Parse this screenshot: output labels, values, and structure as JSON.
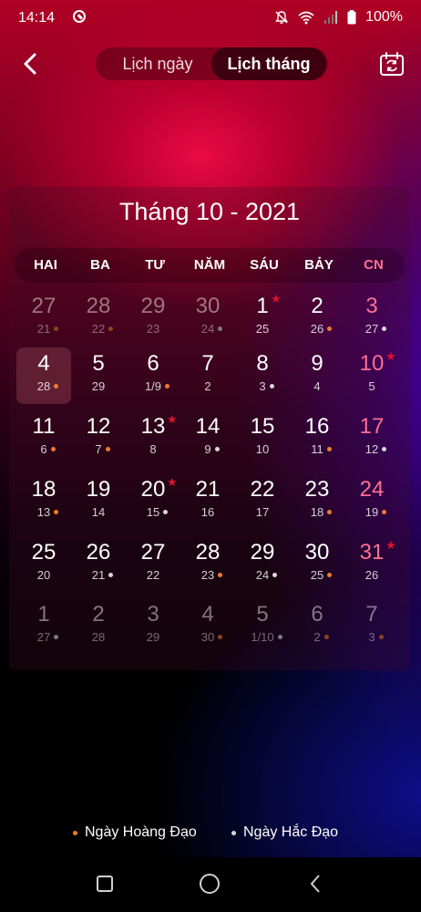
{
  "status": {
    "time": "14:14",
    "battery": "100%",
    "icons": [
      "app-notification-icon",
      "mute-icon",
      "wifi-icon",
      "signal-icon",
      "battery-icon"
    ]
  },
  "header": {
    "tab_day": "Lịch ngày",
    "tab_month": "Lịch tháng",
    "active_tab": "Lịch tháng"
  },
  "calendar": {
    "title": "Tháng 10 - 2021",
    "weekdays": [
      "HAI",
      "BA",
      "TƯ",
      "NĂM",
      "SÁU",
      "BẢY",
      "CN"
    ],
    "weeks": [
      [
        {
          "solar": "27",
          "lunar": "21",
          "dot": "good",
          "other": true
        },
        {
          "solar": "28",
          "lunar": "22",
          "dot": "good",
          "other": true
        },
        {
          "solar": "29",
          "lunar": "23",
          "dot": "",
          "other": true
        },
        {
          "solar": "30",
          "lunar": "24",
          "dot": "bad",
          "other": true
        },
        {
          "solar": "1",
          "lunar": "25",
          "dot": "",
          "star": true
        },
        {
          "solar": "2",
          "lunar": "26",
          "dot": "good"
        },
        {
          "solar": "3",
          "lunar": "27",
          "dot": "bad"
        }
      ],
      [
        {
          "solar": "4",
          "lunar": "28",
          "dot": "good",
          "today": true
        },
        {
          "solar": "5",
          "lunar": "29",
          "dot": ""
        },
        {
          "solar": "6",
          "lunar": "1/9",
          "dot": "good"
        },
        {
          "solar": "7",
          "lunar": "2",
          "dot": ""
        },
        {
          "solar": "8",
          "lunar": "3",
          "dot": "bad"
        },
        {
          "solar": "9",
          "lunar": "4",
          "dot": ""
        },
        {
          "solar": "10",
          "lunar": "5",
          "dot": "",
          "star": true
        }
      ],
      [
        {
          "solar": "11",
          "lunar": "6",
          "dot": "good"
        },
        {
          "solar": "12",
          "lunar": "7",
          "dot": "good"
        },
        {
          "solar": "13",
          "lunar": "8",
          "dot": "",
          "star": true
        },
        {
          "solar": "14",
          "lunar": "9",
          "dot": "bad"
        },
        {
          "solar": "15",
          "lunar": "10",
          "dot": ""
        },
        {
          "solar": "16",
          "lunar": "11",
          "dot": "good"
        },
        {
          "solar": "17",
          "lunar": "12",
          "dot": "bad"
        }
      ],
      [
        {
          "solar": "18",
          "lunar": "13",
          "dot": "good"
        },
        {
          "solar": "19",
          "lunar": "14",
          "dot": ""
        },
        {
          "solar": "20",
          "lunar": "15",
          "dot": "bad",
          "star": true
        },
        {
          "solar": "21",
          "lunar": "16",
          "dot": ""
        },
        {
          "solar": "22",
          "lunar": "17",
          "dot": ""
        },
        {
          "solar": "23",
          "lunar": "18",
          "dot": "good"
        },
        {
          "solar": "24",
          "lunar": "19",
          "dot": "good"
        }
      ],
      [
        {
          "solar": "25",
          "lunar": "20",
          "dot": ""
        },
        {
          "solar": "26",
          "lunar": "21",
          "dot": "bad"
        },
        {
          "solar": "27",
          "lunar": "22",
          "dot": ""
        },
        {
          "solar": "28",
          "lunar": "23",
          "dot": "good"
        },
        {
          "solar": "29",
          "lunar": "24",
          "dot": "bad"
        },
        {
          "solar": "30",
          "lunar": "25",
          "dot": "good"
        },
        {
          "solar": "31",
          "lunar": "26",
          "dot": "",
          "star": true
        }
      ],
      [
        {
          "solar": "1",
          "lunar": "27",
          "dot": "bad",
          "other": true
        },
        {
          "solar": "2",
          "lunar": "28",
          "dot": "",
          "other": true
        },
        {
          "solar": "3",
          "lunar": "29",
          "dot": "",
          "other": true
        },
        {
          "solar": "4",
          "lunar": "30",
          "dot": "good",
          "other": true
        },
        {
          "solar": "5",
          "lunar": "1/10",
          "dot": "bad",
          "other": true
        },
        {
          "solar": "6",
          "lunar": "2",
          "dot": "good",
          "other": true
        },
        {
          "solar": "7",
          "lunar": "3",
          "dot": "good",
          "other": true
        }
      ]
    ]
  },
  "legend": {
    "good_label": "Ngày Hoàng Đạo",
    "bad_label": "Ngày Hắc Đạo"
  },
  "colors": {
    "good_dot": "#f07b2b",
    "bad_dot": "#d8d8d8",
    "sunday": "#ff6f93",
    "star": "#e0102e"
  }
}
